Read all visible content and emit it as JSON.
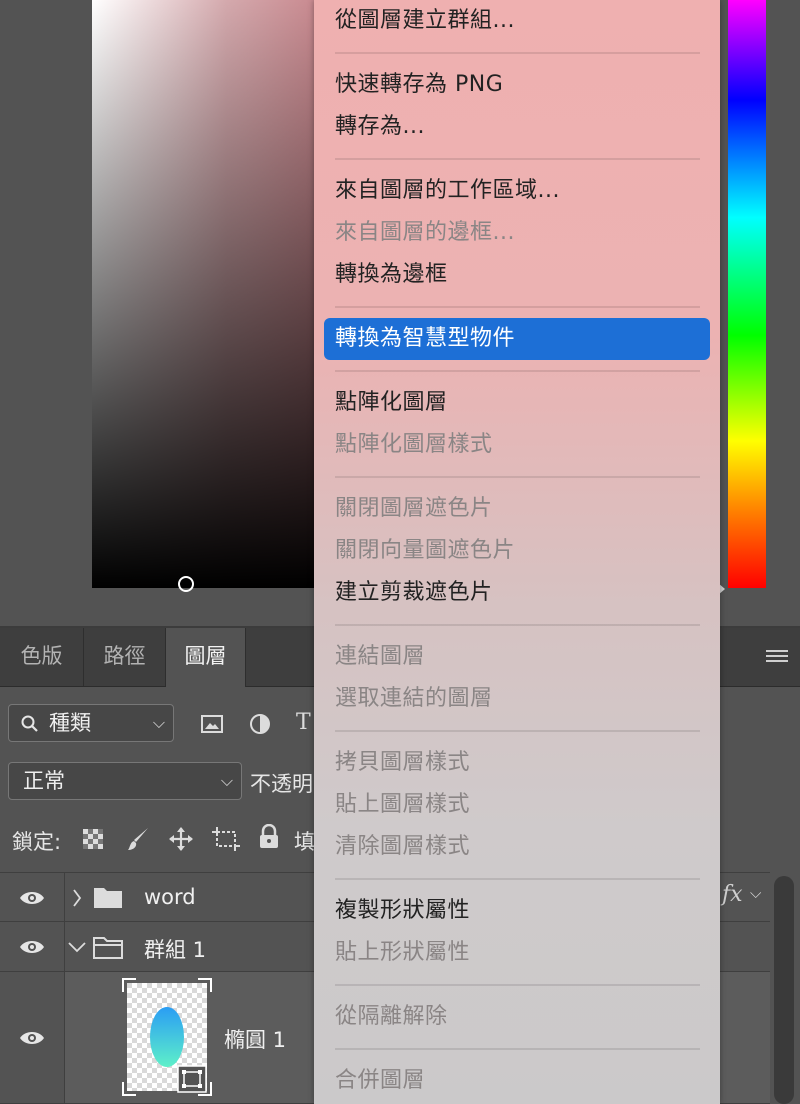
{
  "context_menu": {
    "items": [
      {
        "label": "從圖層建立群組...",
        "enabled": true
      },
      {
        "label": "快速轉存為 PNG",
        "enabled": true
      },
      {
        "label": "轉存為...",
        "enabled": true
      },
      {
        "label": "來自圖層的工作區域...",
        "enabled": true
      },
      {
        "label": "來自圖層的邊框...",
        "enabled": false
      },
      {
        "label": "轉換為邊框",
        "enabled": true
      },
      {
        "label": "轉換為智慧型物件",
        "enabled": true,
        "highlighted": true
      },
      {
        "label": "點陣化圖層",
        "enabled": true
      },
      {
        "label": "點陣化圖層樣式",
        "enabled": false
      },
      {
        "label": "關閉圖層遮色片",
        "enabled": false
      },
      {
        "label": "關閉向量圖遮色片",
        "enabled": false
      },
      {
        "label": "建立剪裁遮色片",
        "enabled": true
      },
      {
        "label": "連結圖層",
        "enabled": false
      },
      {
        "label": "選取連結的圖層",
        "enabled": false
      },
      {
        "label": "拷貝圖層樣式",
        "enabled": false
      },
      {
        "label": "貼上圖層樣式",
        "enabled": false
      },
      {
        "label": "清除圖層樣式",
        "enabled": false
      },
      {
        "label": "複製形狀屬性",
        "enabled": true
      },
      {
        "label": "貼上形狀屬性",
        "enabled": false
      },
      {
        "label": "從隔離解除",
        "enabled": false
      },
      {
        "label": "合併圖層",
        "enabled": false
      }
    ]
  },
  "layers_panel": {
    "tabs": [
      {
        "label": "色版"
      },
      {
        "label": "路徑"
      },
      {
        "label": "圖層",
        "active": true
      }
    ],
    "filter_kind": "種類",
    "blend_mode": "正常",
    "opacity_label": "不透明",
    "lock_label": "鎖定:",
    "fill_label": "填",
    "layers": [
      {
        "name": "word",
        "type": "group",
        "expanded": false,
        "fx": "fx"
      },
      {
        "name": "群組 1",
        "type": "group",
        "expanded": true
      },
      {
        "name": "橢圓 1",
        "type": "shape"
      }
    ]
  },
  "colors": {
    "menu_highlight": "#1d6fd6",
    "panel_bg": "#535353",
    "tab_bar_bg": "#3e3e3e"
  }
}
